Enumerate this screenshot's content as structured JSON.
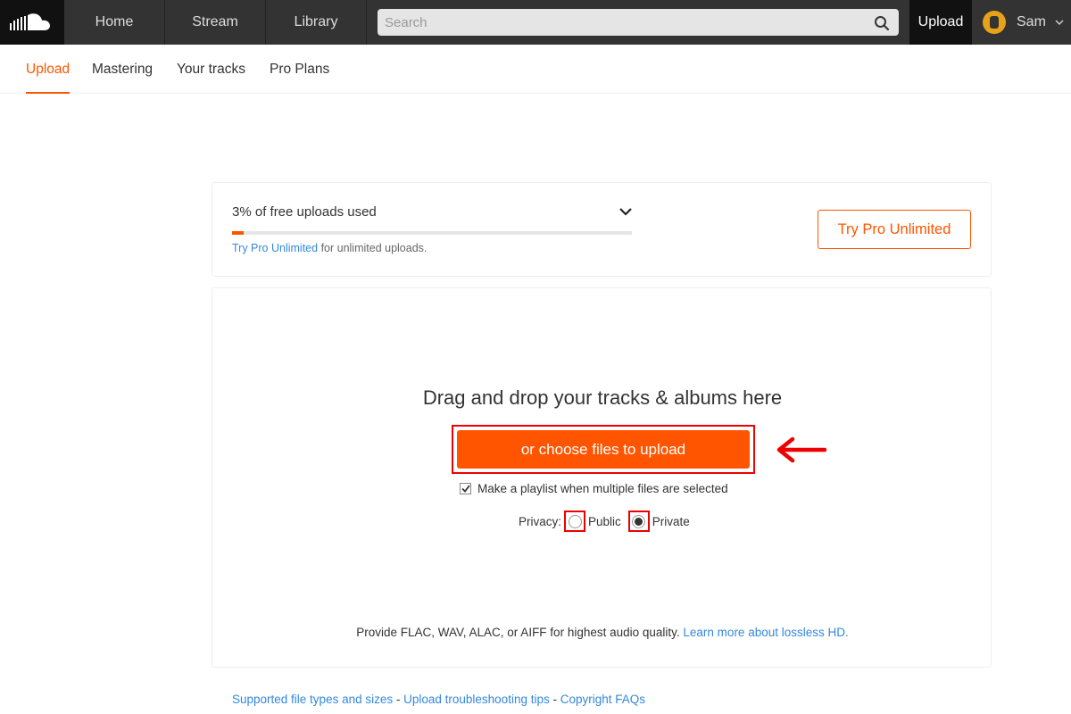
{
  "header": {
    "logo_icon": "soundcloud-logo-icon",
    "nav": [
      "Home",
      "Stream",
      "Library"
    ],
    "search_placeholder": "Search",
    "upload_label": "Upload",
    "user_name": "Sam"
  },
  "subnav": {
    "tabs": [
      "Upload",
      "Mastering",
      "Your tracks",
      "Pro Plans"
    ],
    "active": "Upload"
  },
  "quota": {
    "title": "3% of free uploads used",
    "percent_used": 3,
    "note_link": "Try Pro Unlimited",
    "note_text": " for unlimited uploads.",
    "button_label": "Try Pro Unlimited"
  },
  "dropzone": {
    "title": "Drag and drop your tracks & albums here",
    "choose_button": "or choose files to upload",
    "playlist_label": "Make a playlist when multiple files are selected",
    "playlist_checked": true,
    "privacy_label": "Privacy:",
    "public_label": "Public",
    "private_label": "Private",
    "privacy_selected": "Private",
    "lossless_text": "Provide FLAC, WAV, ALAC, or AIFF for highest audio quality. ",
    "lossless_link": "Learn more about lossless HD."
  },
  "footer": {
    "links": [
      "Supported file types and sizes",
      "Upload troubleshooting tips",
      "Copyright FAQs"
    ],
    "separator": " - "
  },
  "colors": {
    "accent": "#ff5500",
    "annotation": "#ee0000",
    "link": "#3388dd",
    "header_bg": "#333333"
  }
}
